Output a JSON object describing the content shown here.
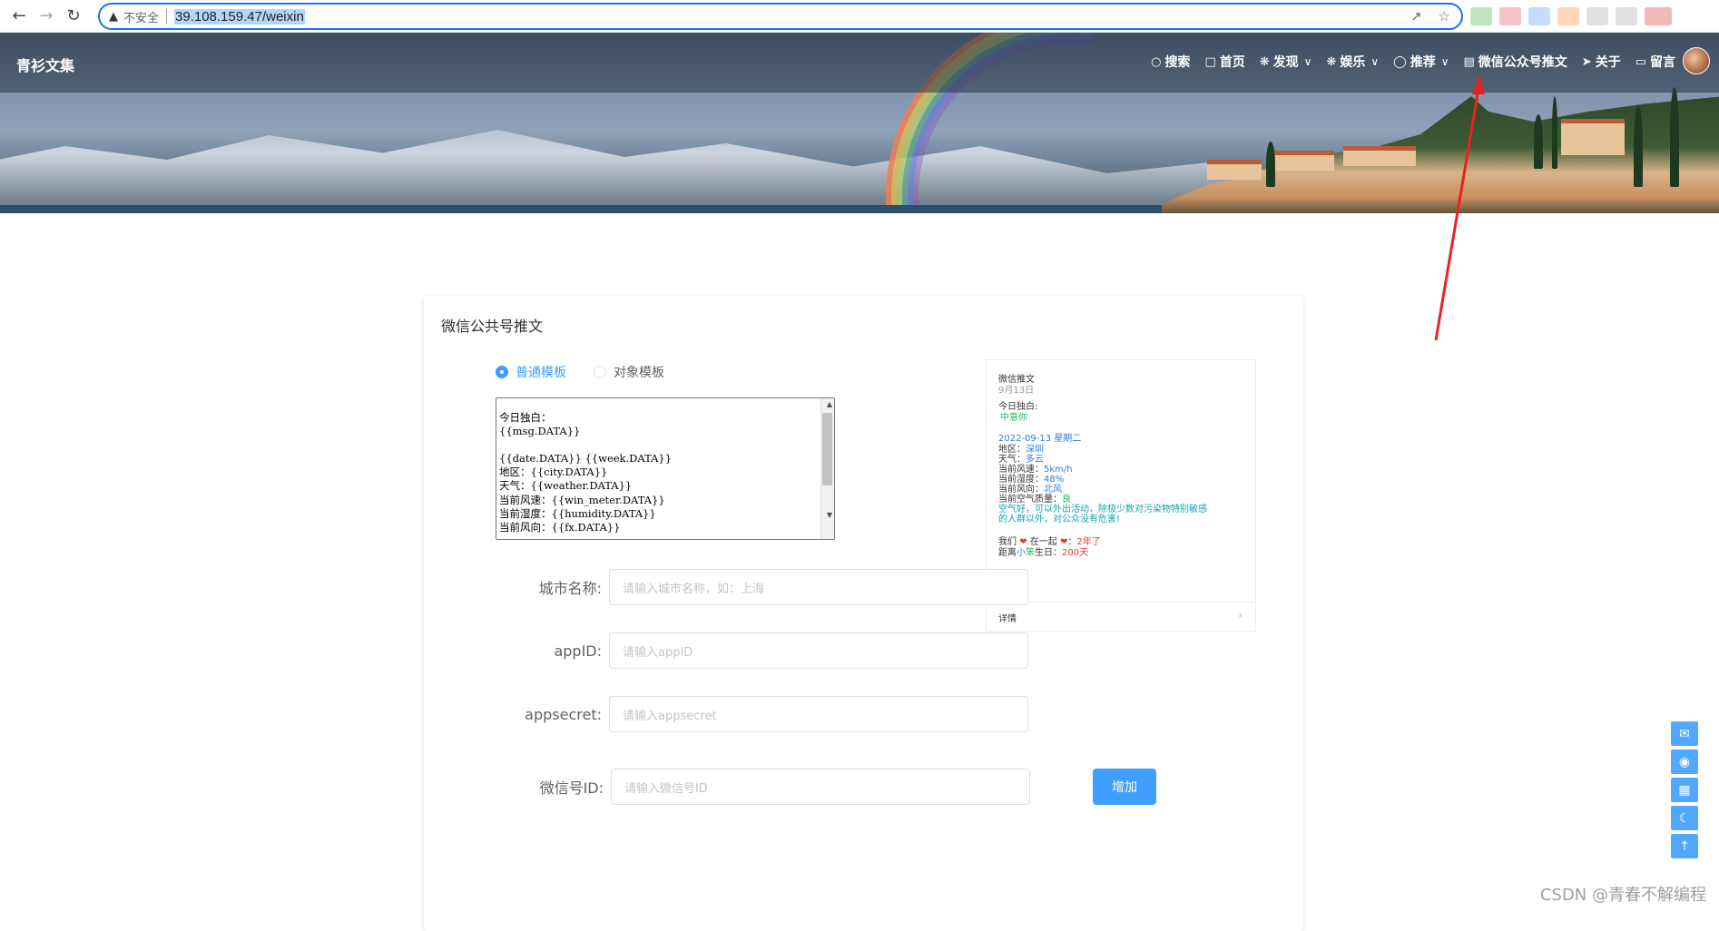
{
  "browser": {
    "back_icon": "arrow-left-icon",
    "forward_icon": "arrow-right-icon",
    "reload_icon": "reload-icon",
    "security_label": "不安全",
    "url": "39.108.159.47/weixin",
    "share_icon": "share-icon",
    "bookmark_icon": "star-icon"
  },
  "header": {
    "site_title": "青衫文集",
    "menu": [
      {
        "icon": "search-icon",
        "label": "搜索",
        "has_dropdown": false
      },
      {
        "icon": "home-icon",
        "label": "首页",
        "has_dropdown": false
      },
      {
        "icon": "discover-icon",
        "label": "发现",
        "has_dropdown": true
      },
      {
        "icon": "entertainment-icon",
        "label": "娱乐",
        "has_dropdown": true
      },
      {
        "icon": "tag-icon",
        "label": "推荐",
        "has_dropdown": true
      },
      {
        "icon": "document-icon",
        "label": "微信公众号推文",
        "has_dropdown": false
      },
      {
        "icon": "send-icon",
        "label": "关于",
        "has_dropdown": false
      },
      {
        "icon": "message-icon",
        "label": "留言",
        "has_dropdown": false
      }
    ]
  },
  "card": {
    "title": "微信公共号推文",
    "radio_options": [
      {
        "label": "普通模板",
        "checked": true
      },
      {
        "label": "对象模板",
        "checked": false
      }
    ],
    "template_text": "今日独白：\n{{msg.DATA}}\n\n{{date.DATA}} {{week.DATA}}\n地区：{{city.DATA}}\n天气：{{weather.DATA}}\n当前风速：{{win_meter.DATA}}\n当前湿度：{{humidity.DATA}}\n当前风向：{{fx.DATA}}",
    "preview": {
      "title": "微信推文",
      "date_small": "9月13日",
      "monologue_label": "今日独白:",
      "monologue_value": "中意你",
      "date_line": "2022-09-13  星期二",
      "region_label": "地区：",
      "region_value": "深圳",
      "weather_label": "天气：",
      "weather_value": "多云",
      "wind_speed_label": "当前风速：",
      "wind_speed_value": "5km/h",
      "humidity_label": "当前湿度：",
      "humidity_value": "48%",
      "wind_dir_label": "当前风向：",
      "wind_dir_value": "北风",
      "air_label": "当前空气质量：",
      "air_value": "良",
      "air_advice_1": "空气好，可以外出活动，除极少数对污染物特别敏感",
      "air_advice_2": "的人群以外，对公众没有危害!",
      "together_prefix": "我们",
      "together_mid": "在一起",
      "together_suffix": "：",
      "together_value": "2年了",
      "birthday_prefix": "距离",
      "birthday_name": "小",
      "birthday_name2": "笨",
      "birthday_mid": "生日：",
      "birthday_value": "200天",
      "detail_label": "详情"
    },
    "form": {
      "city_label": "城市名称:",
      "city_placeholder": "请输入城市名称，如：上海",
      "appid_label": "appID:",
      "appid_placeholder": "请输入appID",
      "appsecret_label": "appsecret:",
      "appsecret_placeholder": "请输入appsecret",
      "wxid_label": "微信号ID:",
      "wxid_placeholder": "请输入微信号ID",
      "add_button": "增加"
    }
  },
  "float_tools": [
    {
      "icon": "chat-icon"
    },
    {
      "icon": "weibo-icon"
    },
    {
      "icon": "qrcode-icon"
    },
    {
      "icon": "moon-icon"
    },
    {
      "icon": "arrow-up-icon"
    }
  ],
  "watermark": "CSDN @青春不解编程",
  "colors": {
    "accent": "#409eff",
    "annotation_arrow": "#e8231f"
  }
}
